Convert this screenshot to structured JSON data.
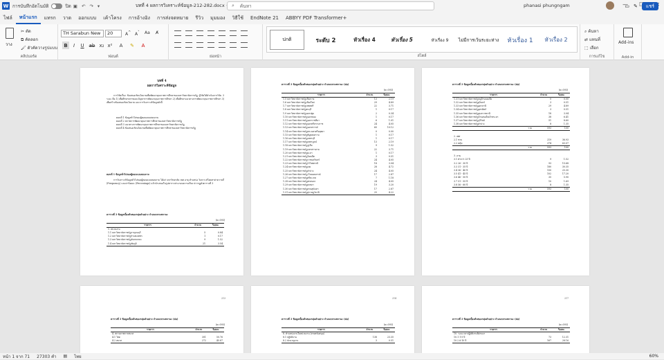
{
  "titlebar": {
    "autosave": "การบันทึกอัตโนมัติ",
    "autosave_state": "ปิด",
    "doc_title": "บทที่ 4 ผลการวิเคราะห์ข้อมูล-212-282.docx • บันทึกไปยัง พีซีนี้ ∨",
    "search_placeholder": "ค้นหา",
    "user_name": "phanasi phungngam"
  },
  "menu": {
    "tabs": [
      "ไฟล์",
      "หน้าแรก",
      "แทรก",
      "วาด",
      "ออกแบบ",
      "เค้าโครง",
      "การอ้างอิง",
      "การส่งจดหมาย",
      "รีวิว",
      "มุมมอง",
      "วิธีใช้",
      "EndNote 21",
      "ABBYY PDF Transformer+"
    ],
    "share_label": "แชร์"
  },
  "ribbon": {
    "clipboard": {
      "paste": "วาง",
      "cut": "ตัด",
      "copy": "คัดลอก",
      "format_painter": "ตัวคัดวางรูปแบบ",
      "label": "คลิปบอร์ด"
    },
    "font": {
      "name": "TH Sarabun New",
      "size": "20",
      "label": "ฟอนต์"
    },
    "paragraph_label": "ย่อหน้า",
    "styles": [
      {
        "label": "ปกติ",
        "selected": true
      },
      {
        "label": "ระดับ 2",
        "selected": false
      },
      {
        "label": "หัวเรื่อง 4",
        "selected": false
      },
      {
        "label": "หัวเรื่อง 5",
        "selected": false
      },
      {
        "label": "หัวเรื่อง 9",
        "selected": false
      },
      {
        "label": "ไม่มีการเว้นระยะห่าง",
        "selected": false
      },
      {
        "label": "หัวเรื่อง 1",
        "selected": false
      },
      {
        "label": "หัวเรื่อง 2",
        "selected": false
      }
    ],
    "styles_label": "สไตล์",
    "editing": {
      "find": "ค้นหา",
      "replace": "แทนที่",
      "select": "เลือก",
      "label": "การแก้ไข"
    },
    "addin": {
      "label": "Add-ins",
      "group": "Add-in"
    }
  },
  "pages": {
    "p1": {
      "chapter": "บทที่ 4",
      "chapter_title": "ผลการวิเคราะห์ข้อมูล",
      "intro": "การวิจัยเรื่อง ข้อเสนอเชิงนโยบายเพื่อพัฒนาคุณภาพการศึกษาของมหาวิทยาลัยราชภัฏ ผู้วิจัยได้ดำเนินการวิจัย 3 ระยะ คือ 1) เพื่อศึกษาสภาพและปัญหาการพัฒนาคุณภาพการศึกษา 2) เพื่อศึกษาแนวทางการพัฒนาคุณภาพการศึกษา 3) เพื่อสร้างข้อเสนอเชิงนโยบาย และการวิเคราะห์ข้อมูลดังนี้",
      "items": [
        "ตอนที่ 1 ข้อมูลทั่วไปของผู้ตอบแบบสอบถาม",
        "ตอนที่ 2 สภาพการพัฒนาคุณภาพการศึกษาของมหาวิทยาลัยราชภัฏ",
        "ตอนที่ 3 แนวทางการพัฒนาคุณภาพการศึกษาของมหาวิทยาลัยราชภัฏ",
        "ตอนที่ 4 ข้อเสนอเชิงนโยบายเพื่อพัฒนาคุณภาพการศึกษาของมหาวิทยาลัยราชภัฏ"
      ],
      "section": "ตอนที่ 1 ข้อมูลทั่วไปของผู้ตอบแบบสอบถาม",
      "section_text": "การวิเคราะห์ข้อมูลทั่วไปของผู้ตอบแบบสอบถาม ได้แก่ มหาวิทยาลัย เพศ อายุ ตำแหน่ง วิเคราะห์โดยหาค่าความถี่ (Frequency) และค่าร้อยละ (Percentage) แล้วนำเสนอในรูปตารางประกอบความเรียง ปรากฏดังตารางที่ 3",
      "table_caption": "ตารางที่ 3 ข้อมูลเบื้องต้นของกลุ่มตัวอย่าง จำแนกตามสถานะ",
      "unit": "(n=593)",
      "headers": [
        "รายการ",
        "จำนวน",
        "ร้อยละ"
      ],
      "rows": [
        [
          "1. หน่วยงาน",
          "",
          ""
        ],
        [
          "1.1 มหาวิทยาลัยราชภัฏกาญจนบุรี",
          "5",
          "0.84"
        ],
        [
          "1.2 มหาวิทยาลัยราชภัฏกำแพงเพชร",
          "1",
          "0.17"
        ],
        [
          "1.3 มหาวิทยาลัยราชภัฏจันทรเกษม",
          "9",
          "1.52"
        ],
        [
          "1.4 มหาวิทยาลัยราชภัฏชัยภูมิ",
          "21",
          "3.54"
        ]
      ]
    },
    "p2": {
      "table_caption": "ตารางที่ 3 ข้อมูลเบื้องต้นของกลุ่มตัวอย่าง จำแนกตามสถานะ (ต่อ)",
      "unit": "(n=593)",
      "headers": [
        "รายการ",
        "จำนวน",
        "ร้อยละ"
      ],
      "rows": [
        [
          "1.5 มหาวิทยาลัยราชภัฏเชียงราย",
          "13",
          "2.19"
        ],
        [
          "1.6 มหาวิทยาลัยราชภัฏเชียงใหม่",
          "29",
          "4.89"
        ],
        [
          "1.7 มหาวิทยาลัยราชภัฏเทพสตรี",
          "22",
          "3.71"
        ],
        [
          "1.8 มหาวิทยาลัยราชภัฏธนบุรี",
          "1",
          "0.17"
        ],
        [
          "1.9 มหาวิทยาลัยราชภัฏนครปฐม",
          "2",
          "0.34"
        ],
        [
          "1.10 มหาวิทยาลัยราชภัฏนครพนม",
          "1",
          "0.17"
        ],
        [
          "1.11 มหาวิทยาลัยราชภัฏนครราชสีมา",
          "6",
          "1.01"
        ],
        [
          "1.12 มหาวิทยาลัยราชภัฏนครศรีธรรมราช",
          "24",
          "4.05"
        ],
        [
          "1.13 มหาวิทยาลัยราชภัฏนครสวรรค์",
          "60",
          "10.12"
        ],
        [
          "1.14 มหาวิทยาลัยราชภัฏพระนครศรีอยุธยา",
          "0",
          "0.00"
        ],
        [
          "1.15 มหาวิทยาลัยราชภัฏพิบูลสงคราม",
          "1",
          "0.17"
        ],
        [
          "1.16 มหาวิทยาลัยราชภัฏเพชรบุรี",
          "1",
          "0.17"
        ],
        [
          "1.17 มหาวิทยาลัยราชภัฏเพชรบูรณ์",
          "13",
          "2.19"
        ],
        [
          "1.18 มหาวิทยาลัยราชภัฏภูเก็ต",
          "9",
          "1.52"
        ],
        [
          "1.19 มหาวิทยาลัยราชภัฏมหาสารคาม",
          "22",
          "3.71"
        ],
        [
          "1.20 มหาวิทยาลัยราชภัฏยะลา",
          "1",
          "0.17"
        ],
        [
          "1.21 มหาวิทยาลัยราชภัฏร้อยเอ็ด",
          "3",
          "0.51"
        ],
        [
          "1.22 มหาวิทยาลัยราชภัฏราชนครินทร์",
          "24",
          "4.05"
        ],
        [
          "1.23 มหาวิทยาลัยราชภัฏรำไพพรรณี",
          "18",
          "3.04"
        ],
        [
          "1.24 มหาวิทยาลัยราชภัฏเลย",
          "28",
          "4.72"
        ],
        [
          "1.25 มหาวิทยาลัยราชภัฏลำปาง",
          "24",
          "4.05"
        ],
        [
          "1.26 มหาวิทยาลัยราชภัฏวไลยอลงกรณ์",
          "17",
          "2.87"
        ],
        [
          "1.27 มหาวิทยาลัยราชภัฏศรีสะเกษ",
          "7",
          "1.18"
        ],
        [
          "1.28 มหาวิทยาลัยราชภัฏสกลนคร",
          "24",
          "4.05"
        ],
        [
          "1.29 มหาวิทยาลัยราชภัฏสงขลา",
          "19",
          "3.20"
        ],
        [
          "1.30 มหาวิทยาลัยราชภัฏสวนสุนันทา",
          "17",
          "2.87"
        ],
        [
          "1.31 มหาวิทยาลัยราชภัฏสุราษฎร์ธานี",
          "25",
          "4.22"
        ]
      ]
    },
    "p3": {
      "table_caption": "ตารางที่ 3 ข้อมูลเบื้องต้นของกลุ่มตัวอย่าง จำแนกตามสถานะ (ต่อ)",
      "unit": "(n=593)",
      "headers": [
        "รายการ",
        "จำนวน",
        "ร้อยละ"
      ],
      "rows": [
        [
          "1.31 มหาวิทยาลัยราชภัฏหมู่บ้านจอมบึง",
          "0",
          "0.00"
        ],
        [
          "1.32 มหาวิทยาลัยราชภัฏสุรินทร์",
          "3",
          "0.51"
        ],
        [
          "1.33 มหาวิทยาลัยราชภัฏอุดรธานี",
          "29",
          "4.89"
        ],
        [
          "1.34 มหาวิทยาลัยราชภัฏอุตรดิตถ์",
          "3",
          "0.51"
        ],
        [
          "1.35 มหาวิทยาลัยราชภัฏอุบลราชธานี",
          "18",
          "3.04"
        ],
        [
          "1.36 มหาวิทยาลัยราชภัฏบ้านสมเด็จเจ้าพระยา",
          "38",
          "6.41"
        ],
        [
          "1.37 มหาวิทยาลัยราชภัฏบุรีรัมย์",
          "51",
          "8.60"
        ],
        [
          "1.38 มหาวิทยาลัยราชภัฏลำปาง",
          "8",
          "1.35"
        ]
      ],
      "total1": [
        "รวม",
        "593",
        "100"
      ],
      "sec2": "2. เพศ",
      "rows2": [
        [
          "2.1 ชาย",
          "219",
          "36.93"
        ],
        [
          "2.2 หญิง",
          "374",
          "63.07"
        ]
      ],
      "total2": [
        "รวม",
        "593",
        "100"
      ],
      "sec3": "3. อายุ",
      "rows3": [
        [
          "3.1 ต่ำกว่า 25 ปี",
          "9",
          "1.52"
        ],
        [
          "3.2 26 - 30 ปี",
          "93",
          "15.68"
        ],
        [
          "3.3 31 - 35 ปี",
          "180",
          "30.35"
        ],
        [
          "3.4 36 - 40 ปี",
          "150",
          "25.30"
        ],
        [
          "3.5 41 - 45 ปี",
          "102",
          "17.20"
        ],
        [
          "3.6 46 - 50 ปี",
          "35",
          "5.90"
        ],
        [
          "3.7 51 - 55 ปี",
          "10",
          "1.69"
        ],
        [
          "3.8 56 - 60 ปี",
          "8",
          "1.35"
        ]
      ],
      "total3": [
        "รวม",
        "593",
        "100"
      ]
    },
    "p4": {
      "page_number": "213",
      "table_caption": "ตารางที่ 3 ข้อมูลเบื้องต้นของกลุ่มตัวอย่าง จำแนกตามสถานะ (ต่อ)",
      "unit": "(n=593)",
      "headers": [
        "รายการ",
        "จำนวน",
        "ร้อยละ"
      ],
      "rows": [
        [
          "4. สถานภาพการสมรส",
          "",
          ""
        ],
        [
          "4.1 โสด",
          "301",
          "50.76"
        ],
        [
          "4.2 สมรส",
          "272",
          "45.87"
        ]
      ]
    },
    "p5": {
      "page_number": "214",
      "table_caption": "ตารางที่ 3 ข้อมูลเบื้องต้นของกลุ่มตัวอย่าง จำแนกตามสถานะ (ต่อ)",
      "unit": "(n=593)",
      "headers": [
        "รายการ",
        "จำนวน",
        "ร้อยละ"
      ],
      "rows": [
        [
          "8. ตำแหน่งงานในหน่วยงาน (สายสนับสนุน)",
          "",
          ""
        ],
        [
          "8.1 ปฏิบัติงาน",
          "138",
          "23.35"
        ],
        [
          "8.2 ชำนาญงาน",
          "3",
          "0.51"
        ]
      ]
    },
    "p6": {
      "page_number": "217",
      "table_caption": "ตารางที่ 3 ข้อมูลเบื้องต้นของกลุ่มตัวอย่าง จำแนกตามสถานะ (ต่อ)",
      "unit": "(n=593)",
      "headers": [
        "รายการ",
        "จำนวน",
        "ร้อยละ"
      ],
      "rows": [
        [
          "10. ระยะเวลาปฏิบัติงานที่ผ่านมา",
          "",
          ""
        ],
        [
          "10.1 1-5 ปี",
          "73",
          "12.31"
        ],
        [
          "10.2 6-10 ปี",
          "167",
          "28.16"
        ]
      ]
    }
  },
  "status": {
    "page": "หน้า 1 จาก 71",
    "words": "27303 คำ",
    "language": "ไทย",
    "zoom": "60%"
  }
}
